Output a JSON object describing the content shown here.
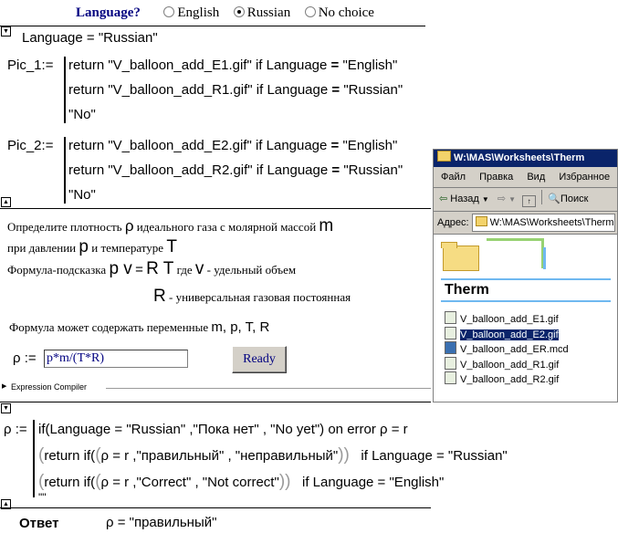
{
  "lang_bar": {
    "question": "Language?",
    "options": [
      {
        "label": "English",
        "selected": false
      },
      {
        "label": "Russian",
        "selected": true
      },
      {
        "label": "No choice",
        "selected": false
      }
    ]
  },
  "language_def": "Language = \"Russian\"",
  "pic1": {
    "name": "Pic_1:=",
    "lines": [
      {
        "a": "return  \"V_balloon_add_E1.gif\"  if  Language",
        "eq": " = ",
        "b": "\"English\""
      },
      {
        "a": "return  \"V_balloon_add_R1.gif\"  if  Language",
        "eq": " = ",
        "b": "\"Russian\""
      },
      {
        "a": "\"No\"",
        "eq": "",
        "b": ""
      }
    ]
  },
  "pic2": {
    "name": "Pic_2:=",
    "lines": [
      {
        "a": "return  \"V_balloon_add_E2.gif\"  if  Language",
        "eq": " = ",
        "b": "\"English\""
      },
      {
        "a": "return  \"V_balloon_add_R2.gif\"  if  Language",
        "eq": " = ",
        "b": "\"Russian\""
      },
      {
        "a": "\"No\"",
        "eq": "",
        "b": ""
      }
    ]
  },
  "task": {
    "l1_a": "Определите плотность ",
    "rho": "ρ",
    "l1_b": " идеального газа с молярной массой ",
    "m": "m",
    "l2_a": "при давлении ",
    "p": "p",
    "l2_b": " и температуре ",
    "T": "T",
    "l3_a": "Формула-подсказка ",
    "pv": "p v",
    "eq": "=",
    "RT": "R T",
    "l3_b": " где ",
    "v": "v",
    "l3_c": " - удельный объем",
    "R": "R",
    "l4": " - универсальная газовая постоянная",
    "l5_a": "Формула может содержать переменные ",
    "vars": "m, p, T, R"
  },
  "answer_input": {
    "label": "ρ :=",
    "value": "p*m/(T*R)"
  },
  "ready_button": "Ready",
  "expression_compiler": "Expression Compiler",
  "rho_block": {
    "head": "ρ :=",
    "line1": "if(Language = \"Russian\" ,\"Пока нет\" , \"No yet\") on error  ρ = r",
    "line2_a": "return  if(",
    "line2_b": "ρ = r ,\"правильный\" , \"неправильный\"",
    "line2_c": "if   Language = \"Russian\"",
    "line3_a": "return  if(",
    "line3_b": "ρ = r ,\"Correct\" , \"Not correct\"",
    "line3_c": "if   Language = \"English\"",
    "line4": "\"\""
  },
  "result": {
    "label": "Ответ",
    "value": "ρ = \"правильный\""
  },
  "explorer": {
    "title": "W:\\MAS\\Worksheets\\Therm",
    "menu": [
      "Файл",
      "Правка",
      "Вид",
      "Избранное"
    ],
    "back": "Назад",
    "search": "Поиск",
    "address_label": "Адрес:",
    "address": "W:\\MAS\\Worksheets\\Therm",
    "folder_name": "Therm",
    "files": [
      {
        "name": "V_balloon_add_E1.gif",
        "selected": false
      },
      {
        "name": "V_balloon_add_E2.gif",
        "selected": true
      },
      {
        "name": "V_balloon_add_ER.mcd",
        "selected": false
      },
      {
        "name": "V_balloon_add_R1.gif",
        "selected": false
      },
      {
        "name": "V_balloon_add_R2.gif",
        "selected": false
      }
    ],
    "colors": {
      "title_bar": "#0a246a",
      "selection": "#0a246a",
      "accent_bar": "#6fb8f0"
    }
  },
  "colors": {
    "input_text": "#000080",
    "lang_question": "#000080"
  }
}
